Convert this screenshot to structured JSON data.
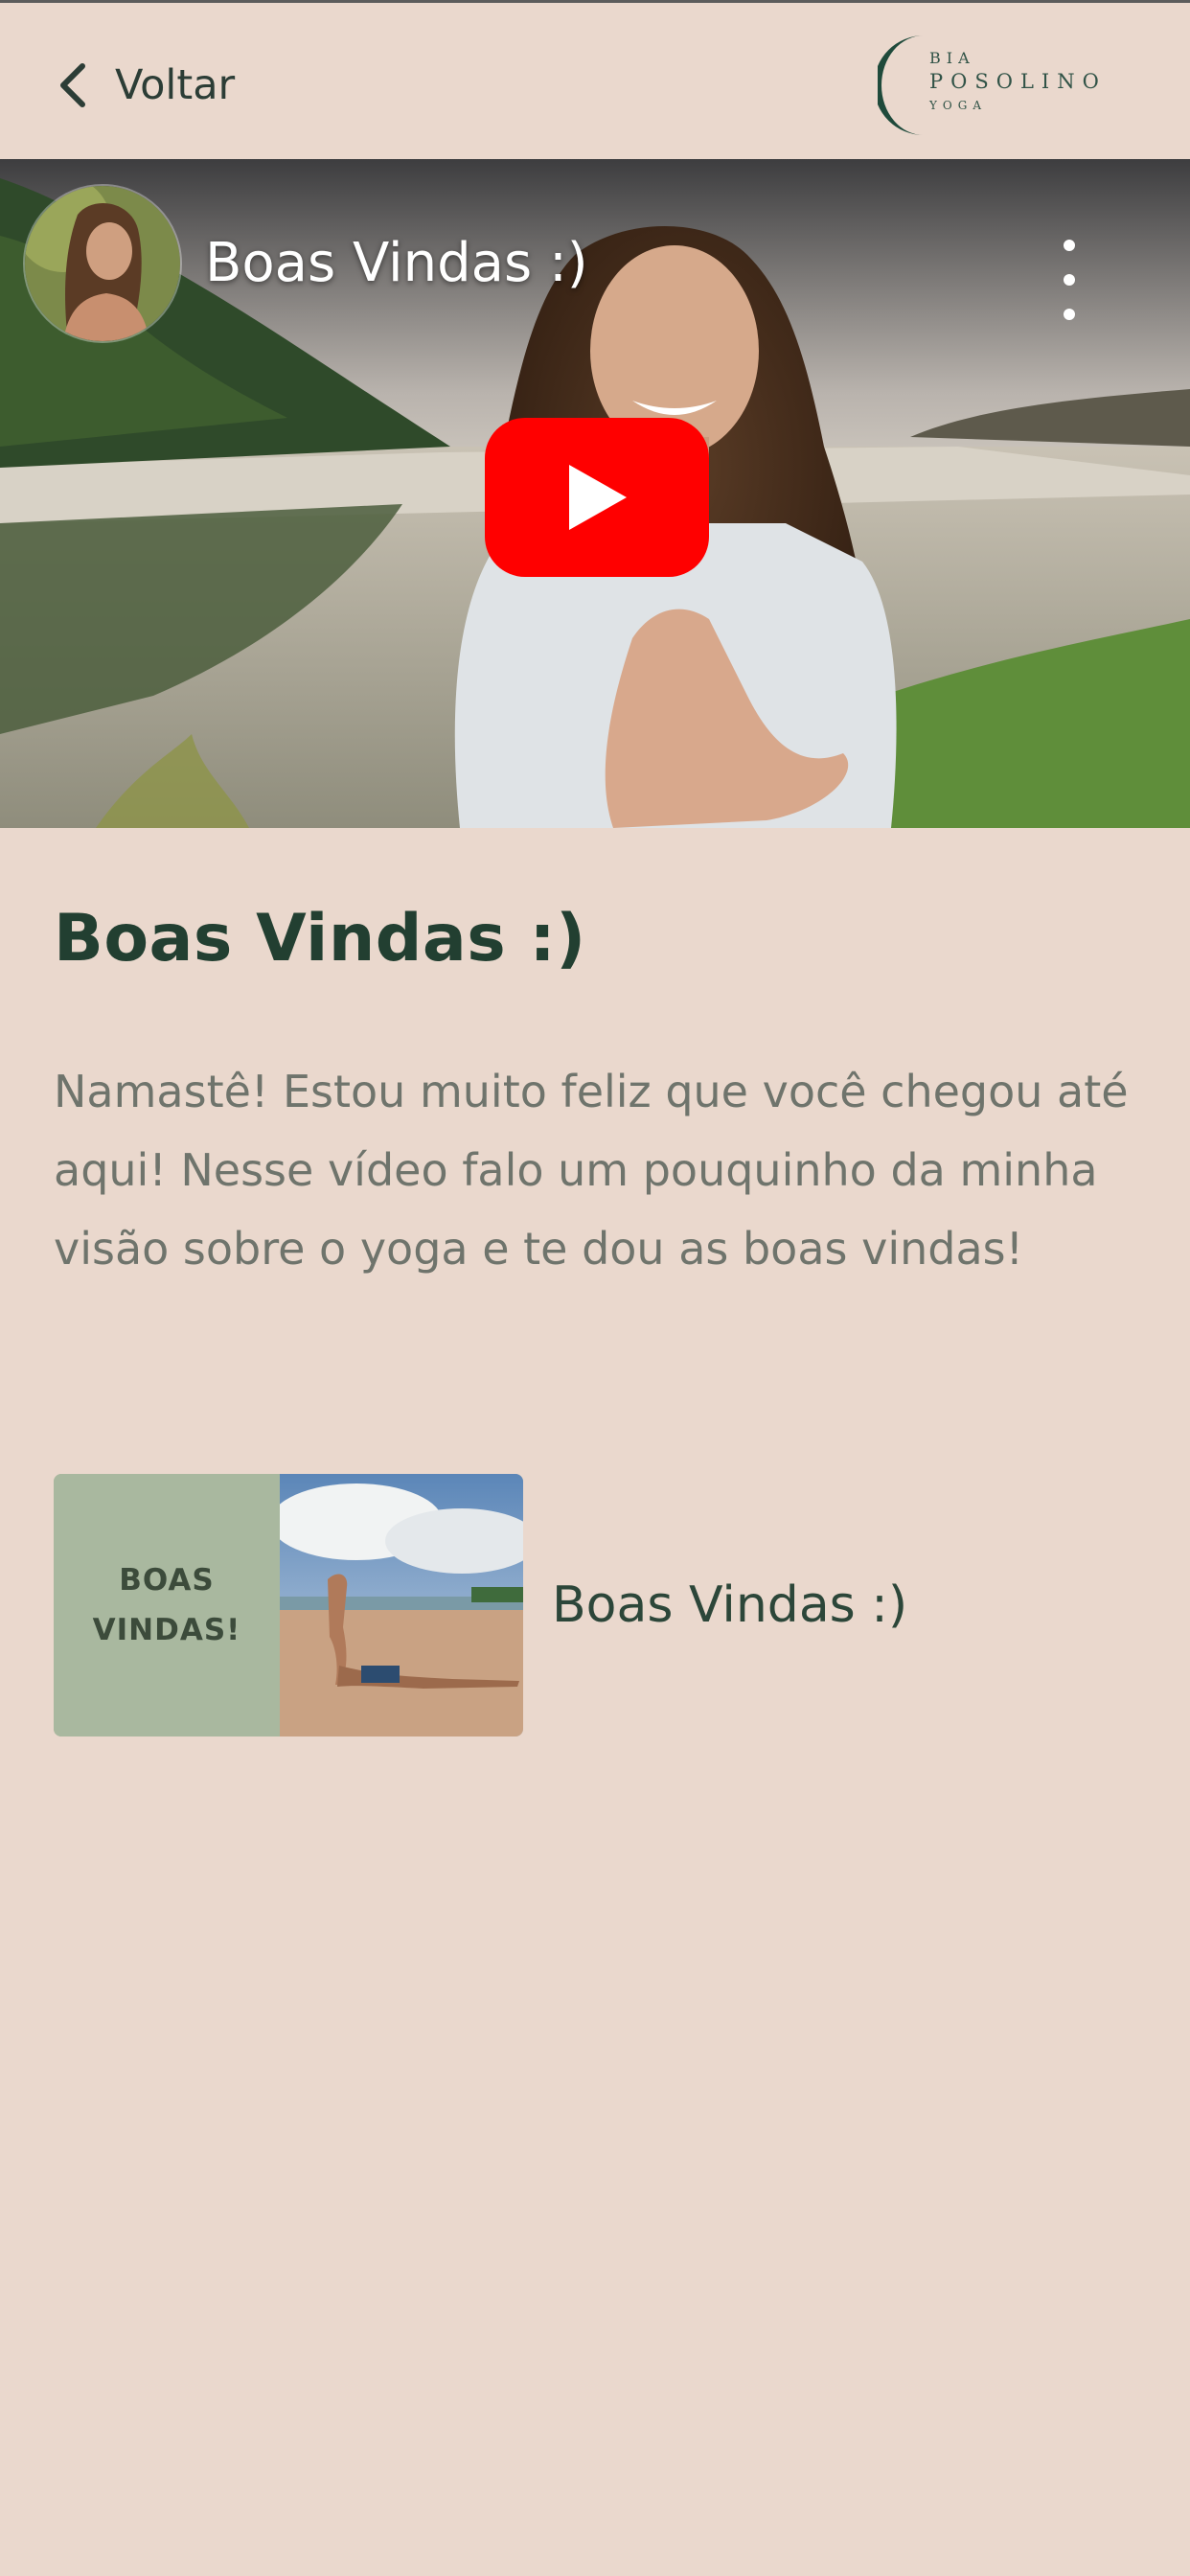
{
  "header": {
    "back_label": "Voltar",
    "logo": {
      "line1": "BIA",
      "line2": "POSOLINO",
      "line3": "YOGA"
    }
  },
  "video": {
    "title": "Boas Vindas :)",
    "play_button_color": "#ff0000"
  },
  "lesson": {
    "title": "Boas Vindas :)",
    "description": "Namastê! Estou muito feliz que você chegou até aqui! Nesse vídeo falo um pouquinho da minha visão sobre o yoga e te dou as boas vindas!"
  },
  "lesson_list": [
    {
      "thumbnail_line1": "BOAS",
      "thumbnail_line2": "VINDAS!",
      "label": "Boas Vindas :)"
    }
  ],
  "colors": {
    "background": "#ead8cd",
    "heading": "#223f31",
    "body_text": "#6f746c",
    "thumbnail_panel": "#a9b89f"
  }
}
